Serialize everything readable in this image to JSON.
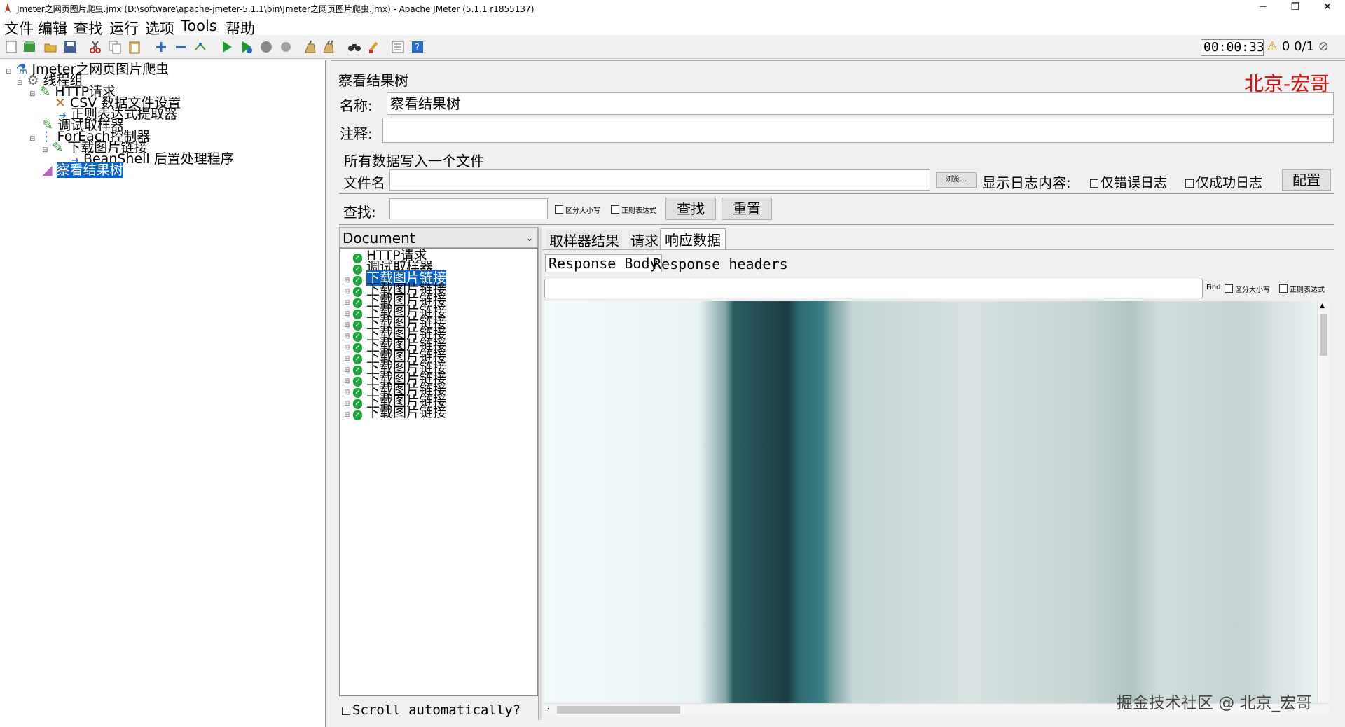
{
  "window": {
    "title": "Jmeter之网页图片爬虫.jmx (D:\\software\\apache-jmeter-5.1.1\\bin\\Jmeter之网页图片爬虫.jmx) - Apache JMeter (5.1.1 r1855137)",
    "minimize": "─",
    "restore": "❐",
    "close": "✕"
  },
  "menu": [
    "文件",
    "编辑",
    "查找",
    "运行",
    "选项",
    "Tools",
    "帮助"
  ],
  "status": {
    "timer": "00:00:33",
    "warnings": "0",
    "threads": "0/1"
  },
  "tree": {
    "root": "Jmeter之网页图片爬虫",
    "thread_group": "线程组",
    "http_request": "HTTP请求",
    "csv": "CSV 数据文件设置",
    "regex": "正则表达式提取器",
    "debug": "调试取样器",
    "foreach": "ForEach控制器",
    "download": "下载图片链接",
    "beanshell": "BeanShell 后置处理程序",
    "view_results": "察看结果树"
  },
  "panel": {
    "title": "察看结果树",
    "brand": "北京-宏哥",
    "name_label": "名称:",
    "name_value": "察看结果树",
    "comment_label": "注释:",
    "comment_value": "",
    "write_all": "所有数据写入一个文件",
    "filename_label": "文件名",
    "filename_value": "",
    "browse": "浏览...",
    "log_label": "显示日志内容:",
    "errors_only": "仅错误日志",
    "success_only": "仅成功日志",
    "configure": "配置",
    "search_label": "查找:",
    "search_value": "",
    "case_sensitive": "区分大小写",
    "regex_option": "正则表达式",
    "search_btn": "查找",
    "reset_btn": "重置"
  },
  "results": {
    "renderer": "Document",
    "items": [
      "HTTP请求",
      "调试取样器",
      "下载图片链接",
      "下载图片链接",
      "下载图片链接",
      "下载图片链接",
      "下载图片链接",
      "下载图片链接",
      "下载图片链接",
      "下载图片链接",
      "下载图片链接",
      "下载图片链接",
      "下载图片链接",
      "下载图片链接",
      "下载图片链接"
    ],
    "scroll": "Scroll automatically?"
  },
  "detail_tabs": [
    "取样器结果",
    "请求",
    "响应数据"
  ],
  "sub_tabs": [
    "Response Body",
    "Response headers"
  ],
  "find": {
    "label": "Find",
    "case": "区分大小写",
    "regex": "正则表达式"
  },
  "watermark": "掘金技术社区 @ 北京_宏哥",
  "colors": {
    "selection": "#0a64c8",
    "brand_red": "#e01010",
    "success_green": "#1ea83c"
  }
}
